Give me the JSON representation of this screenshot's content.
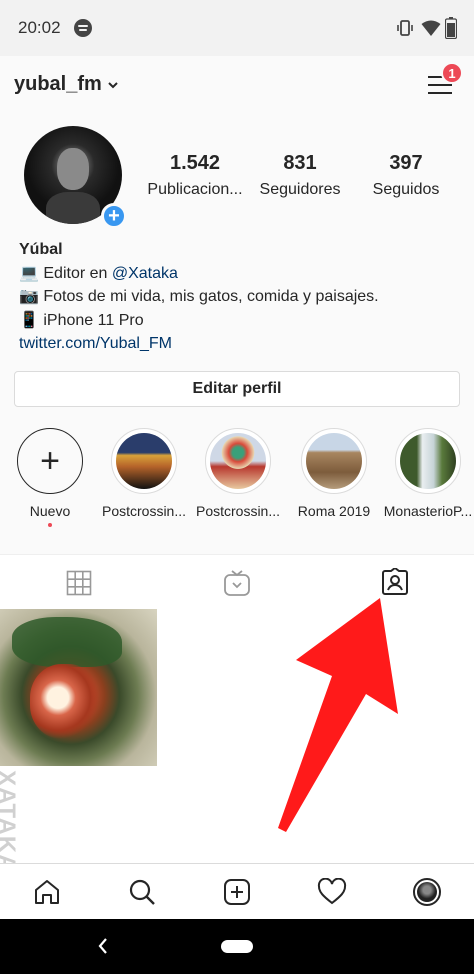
{
  "status_bar": {
    "time": "20:02",
    "icons": [
      "spotify-icon",
      "vibrate-icon",
      "wifi-icon",
      "battery-icon"
    ]
  },
  "top_bar": {
    "username": "yubal_fm",
    "notification_count": "1",
    "icons": [
      "chevron-down-icon",
      "menu-icon"
    ]
  },
  "profile": {
    "stats": [
      {
        "count": "1.542",
        "label": "Publicacion..."
      },
      {
        "count": "831",
        "label": "Seguidores"
      },
      {
        "count": "397",
        "label": "Seguidos"
      }
    ],
    "bio": {
      "name": "Yúbal",
      "line1_prefix": "💻 Editor en ",
      "line1_mention": "@Xataka",
      "line2": "📷 Fotos de mi vida, mis gatos, comida y paisajes.",
      "line3": "📱 iPhone 11 Pro",
      "link": "twitter.com/Yubal_FM"
    },
    "edit_button": "Editar perfil"
  },
  "highlights": [
    {
      "label": "Nuevo",
      "symbol": "+"
    },
    {
      "label": "Postcrossin..."
    },
    {
      "label": "Postcrossin..."
    },
    {
      "label": "Roma 2019"
    },
    {
      "label": "MonasterioP..."
    }
  ],
  "tabs": {
    "items": [
      "grid-tab",
      "igtv-tab",
      "tagged-tab"
    ],
    "active": "tagged-tab"
  },
  "watermark": "XATAKA BASICS",
  "bottom_nav": {
    "items": [
      "home-icon",
      "search-icon",
      "add-post-icon",
      "activity-icon",
      "profile-avatar"
    ]
  },
  "colors": {
    "badge": "#ed4956",
    "accent_blue": "#3897f0",
    "link": "#003569",
    "arrow": "#ff1a1a"
  }
}
